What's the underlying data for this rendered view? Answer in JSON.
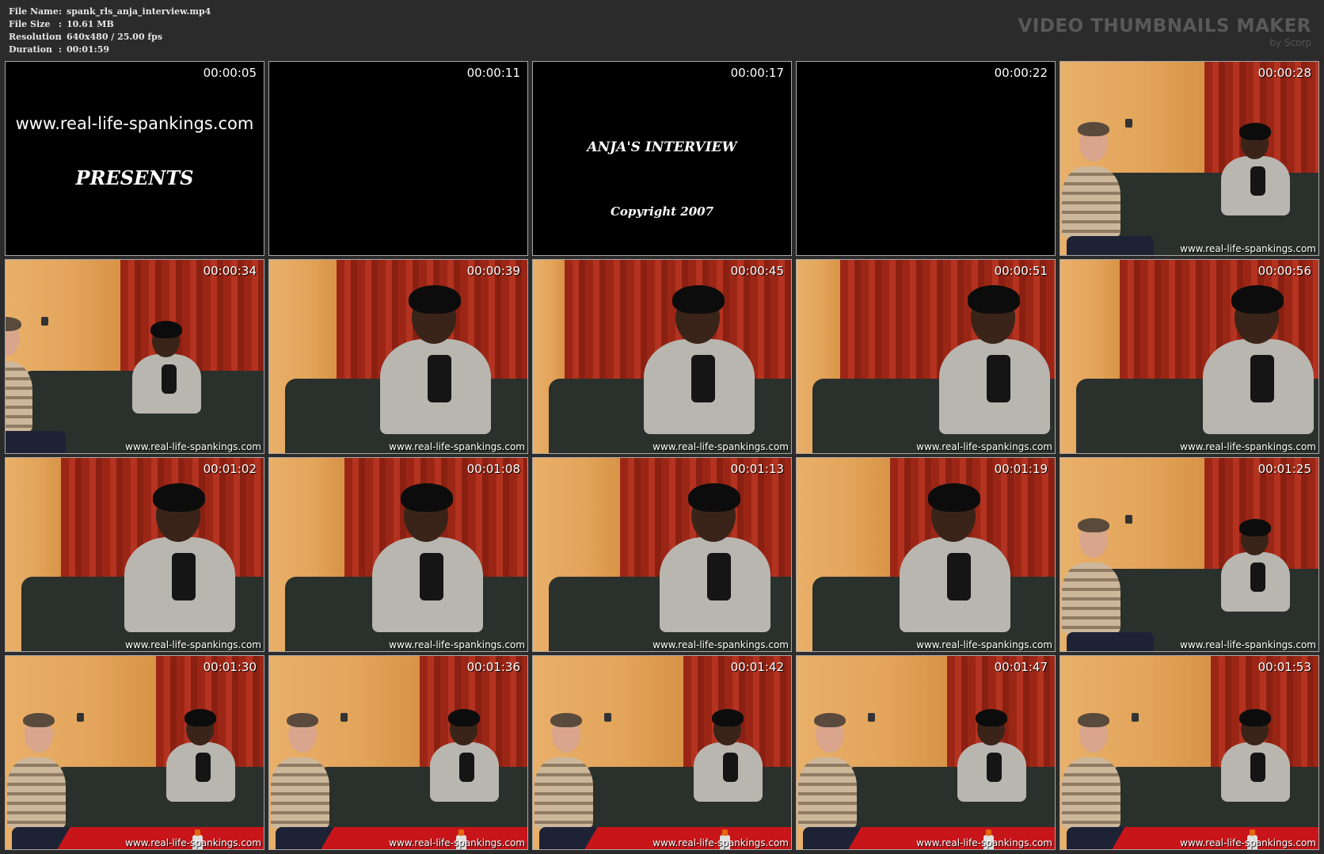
{
  "meta": [
    {
      "label": "File Name",
      "sep": ":",
      "value": "spank_rls_anja_interview.mp4"
    },
    {
      "label": "File Size",
      "sep": ":",
      "value": "10.61 MB"
    },
    {
      "label": "Resolution",
      "sep": ":",
      "value": "640x480 / 25.00 fps"
    },
    {
      "label": "Duration",
      "sep": ":",
      "value": "00:01:59"
    }
  ],
  "brand": {
    "title": "VIDEO THUMBNAILS MAKER",
    "by": "by Scorp"
  },
  "watermark": "www.real-life-spankings.com",
  "titles": {
    "site": "www.real-life-spankings.com",
    "presents": "PRESENTS",
    "interview": "ANJA'S INTERVIEW",
    "copyright": "Copyright 2007"
  },
  "thumbnails": [
    {
      "time": "00:00:05",
      "scene": "title-site"
    },
    {
      "time": "00:00:11",
      "scene": "black"
    },
    {
      "time": "00:00:17",
      "scene": "title-interview"
    },
    {
      "time": "00:00:22",
      "scene": "black"
    },
    {
      "time": "00:00:28",
      "scene": "wide-two"
    },
    {
      "time": "00:00:34",
      "scene": "wide-woman"
    },
    {
      "time": "00:00:39",
      "scene": "close-woman"
    },
    {
      "time": "00:00:45",
      "scene": "close-woman"
    },
    {
      "time": "00:00:51",
      "scene": "close-woman"
    },
    {
      "time": "00:00:56",
      "scene": "close-woman"
    },
    {
      "time": "00:01:02",
      "scene": "close-woman"
    },
    {
      "time": "00:01:08",
      "scene": "close-woman"
    },
    {
      "time": "00:01:13",
      "scene": "close-woman"
    },
    {
      "time": "00:01:19",
      "scene": "close-woman"
    },
    {
      "time": "00:01:25",
      "scene": "wide-two"
    },
    {
      "time": "00:01:30",
      "scene": "wide-table"
    },
    {
      "time": "00:01:36",
      "scene": "wide-table"
    },
    {
      "time": "00:01:42",
      "scene": "wide-table"
    },
    {
      "time": "00:01:47",
      "scene": "wide-table"
    },
    {
      "time": "00:01:53",
      "scene": "wide-table"
    }
  ],
  "colors": {
    "background": "#2b2b2b",
    "wall": "#e2a45a",
    "curtain": "#a22a1a",
    "sofa": "#2a302b",
    "table": "#c8151a"
  }
}
